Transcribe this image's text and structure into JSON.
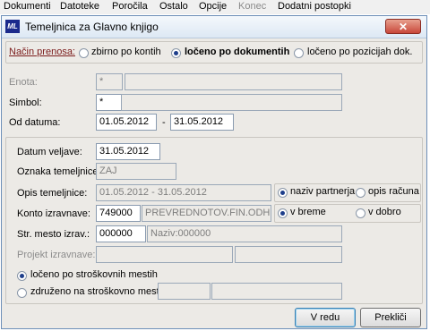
{
  "menu": [
    "Dokumenti",
    "Datoteke",
    "Poročila",
    "Ostalo",
    "Opcije",
    "Konec",
    "Dodatni postopki"
  ],
  "window": {
    "title": "Temeljnica za Glavno knjigo",
    "close_glyph": "✕",
    "icon_text": "ML"
  },
  "transfer": {
    "label": "Način prenosa:",
    "options": [
      "zbirno po kontih",
      "ločeno po dokumentih",
      "ločeno po pozicijah dok."
    ],
    "selected": 1
  },
  "enota": {
    "label": "Enota:",
    "code": "*",
    "name": ""
  },
  "simbol": {
    "label": "Simbol:",
    "code": "*",
    "name": ""
  },
  "date_range": {
    "label": "Od datuma:",
    "from": "01.05.2012",
    "separator": "-",
    "to": "31.05.2012"
  },
  "datum_veljave": {
    "label": "Datum veljave:",
    "value": "31.05.2012"
  },
  "oznaka": {
    "label": "Oznaka temeljnice:",
    "value": "ZAJ"
  },
  "opis": {
    "label": "Opis temeljnice:",
    "value": "01.05.2012 - 31.05.2012"
  },
  "opis_options": {
    "options": [
      "naziv partnerja",
      "opis računa"
    ],
    "selected": 0
  },
  "konto": {
    "label": "Konto izravnave:",
    "code": "749000",
    "name": "PREVREDNOTOV.FIN.ODH.-K"
  },
  "konto_options": {
    "options": [
      "v breme",
      "v dobro"
    ],
    "selected": 0
  },
  "str_mesto": {
    "label": "Str. mesto izrav.:",
    "code": "000000",
    "name": "Naziv:000000"
  },
  "projekt": {
    "label": "Projekt izravnave:"
  },
  "cost_mode": {
    "options": [
      "ločeno po stroškovnih mestih",
      "združeno na stroškovno mesto:"
    ],
    "selected": 0
  },
  "buttons": {
    "ok": "V redu",
    "cancel": "Prekliči"
  },
  "colors": {
    "link": "#7a1a1a",
    "close": "#c8473a",
    "selected_radio": "#1d3d8a"
  }
}
